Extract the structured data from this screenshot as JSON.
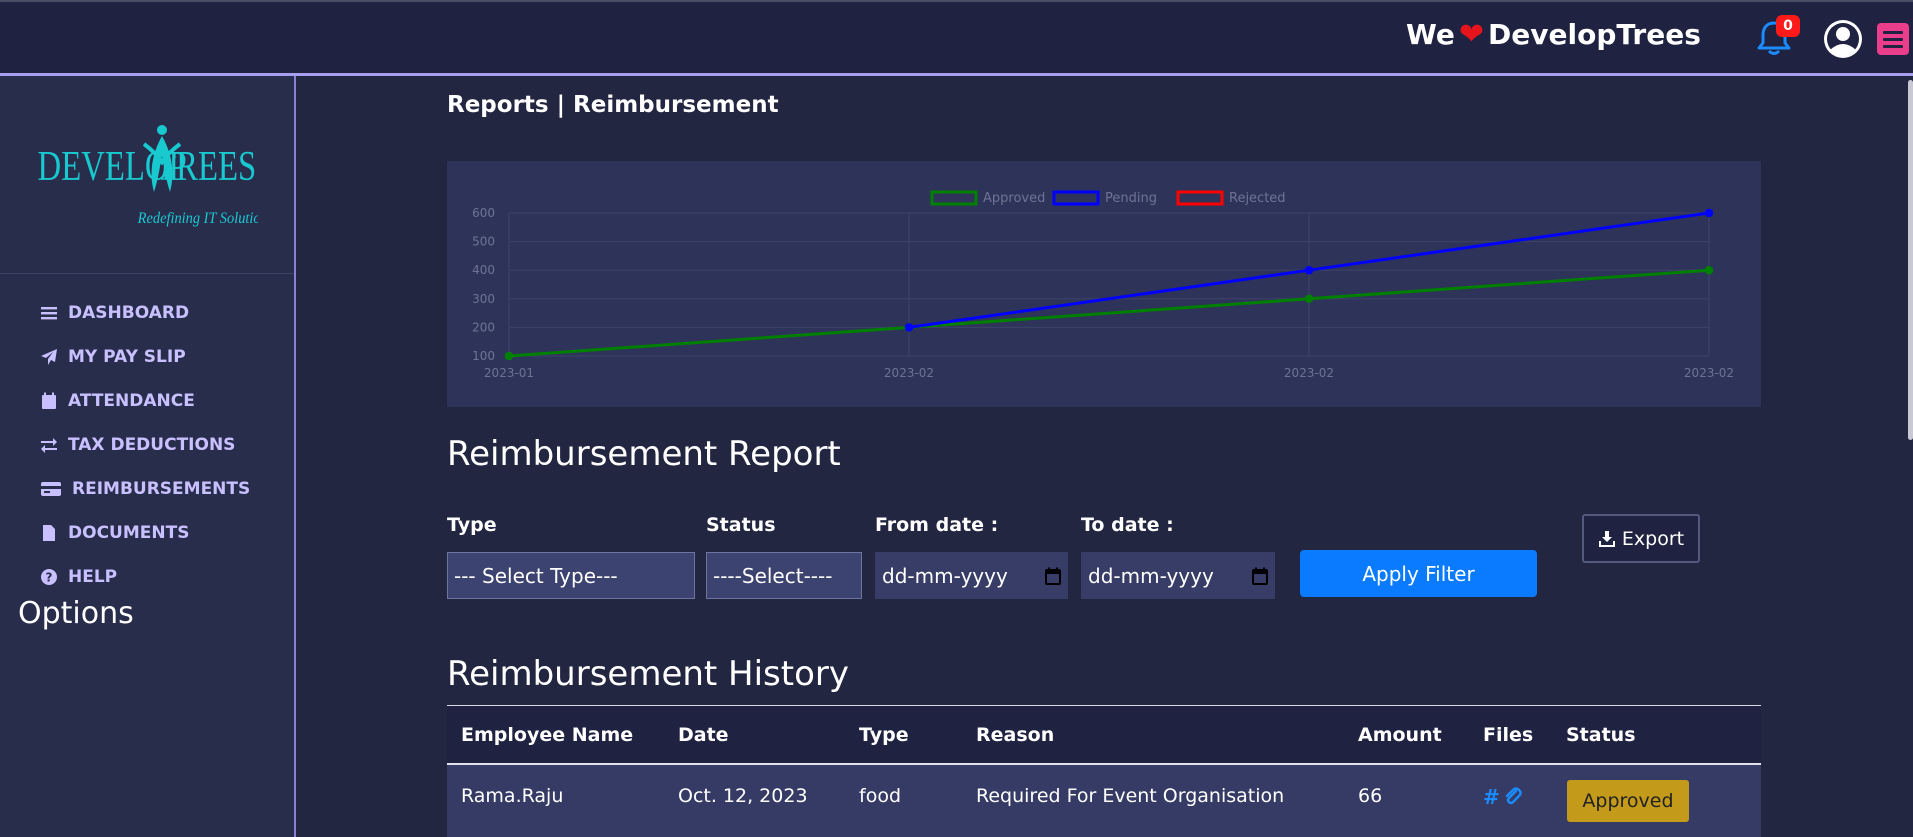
{
  "header": {
    "brand_prefix": "We",
    "brand_name": "DevelopTrees",
    "notification_count": "0",
    "icons": {
      "heart": "heart-icon",
      "bell": "bell-icon",
      "user": "user-circle-icon",
      "menu": "hamburger-icon"
    },
    "colors": {
      "heart": "#e8141c",
      "bell": "#1a8cff",
      "badge": "#ff1a1a",
      "menu": "#ea3d8b"
    }
  },
  "sidebar": {
    "logo": {
      "word_left": "DEVELOP",
      "word_right": "TREES",
      "tagline": "Redefining IT Solutions",
      "color": "#19c9d0"
    },
    "items": [
      {
        "label": "DASHBOARD",
        "icon": "bars-icon"
      },
      {
        "label": "MY PAY SLIP",
        "icon": "paper-plane-icon"
      },
      {
        "label": "ATTENDANCE",
        "icon": "calendar-icon"
      },
      {
        "label": "TAX DEDUCTIONS",
        "icon": "exchange-icon"
      },
      {
        "label": "REIMBURSEMENTS",
        "icon": "credit-card-icon"
      },
      {
        "label": "DOCUMENTS",
        "icon": "file-icon"
      },
      {
        "label": "HELP",
        "icon": "question-circle-icon"
      }
    ],
    "options_heading": "Options"
  },
  "page": {
    "breadcrumb": "Reports | Reimbursement"
  },
  "chart_data": {
    "type": "line",
    "title": "",
    "xlabel": "",
    "ylabel": "",
    "x": [
      "2023-01",
      "2023-02",
      "2023-02",
      "2023-02"
    ],
    "ylim": [
      100,
      600
    ],
    "yticks": [
      100,
      200,
      300,
      400,
      500,
      600
    ],
    "grid": true,
    "legend_position": "top-center",
    "series": [
      {
        "name": "Approved",
        "color": "#008000",
        "values": [
          100,
          200,
          300,
          400
        ]
      },
      {
        "name": "Pending",
        "color": "#0000ff",
        "values": [
          null,
          200,
          400,
          600
        ]
      },
      {
        "name": "Rejected",
        "color": "#ff0000",
        "values": []
      }
    ]
  },
  "report": {
    "title": "Reimbursement Report",
    "filters": {
      "type_label": "Type",
      "type_value": "--- Select Type---",
      "status_label": "Status",
      "status_value": "----Select----",
      "from_label": "From date :",
      "from_placeholder": "dd-mm-yyyy",
      "to_label": "To date :",
      "to_placeholder": "dd-mm-yyyy"
    },
    "apply_label": "Apply Filter",
    "export_label": "Export"
  },
  "history": {
    "title": "Reimbursement History",
    "columns": [
      "Employee Name",
      "Date",
      "Type",
      "Reason",
      "Amount",
      "Files",
      "Status"
    ],
    "rows": [
      {
        "employee": "Rama.Raju",
        "date": "Oct. 12, 2023",
        "type": "food",
        "reason": "Required For Event Organisation",
        "amount": "66",
        "files": "#",
        "status": "Approved",
        "status_color": "#c49a1a"
      }
    ]
  }
}
